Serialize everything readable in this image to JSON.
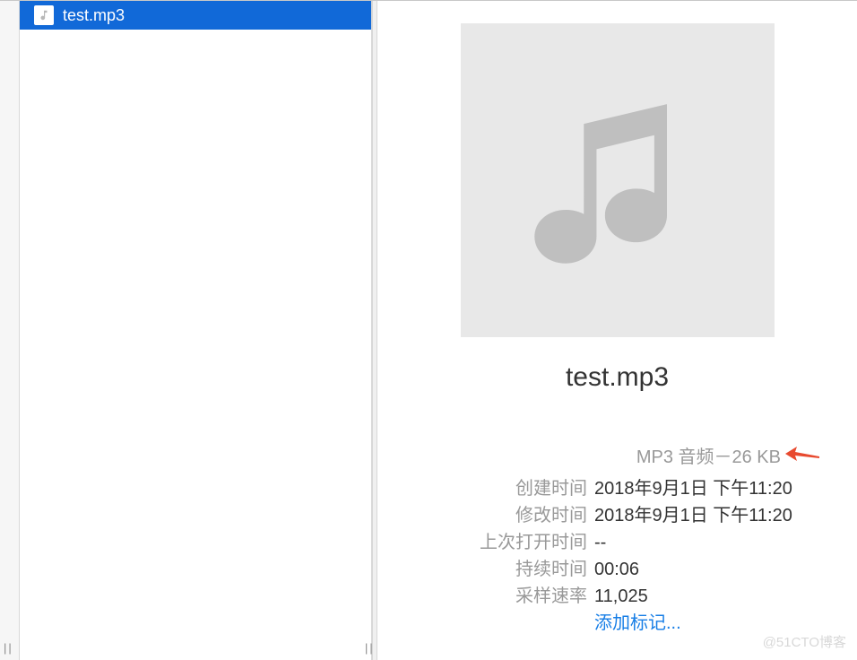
{
  "file_list": {
    "items": [
      {
        "name": "test.mp3"
      }
    ]
  },
  "preview": {
    "title": "test.mp3",
    "type_line": "MP3 音频－26 KB",
    "rows": [
      {
        "label": "创建时间",
        "value": "2018年9月1日 下午11:20"
      },
      {
        "label": "修改时间",
        "value": "2018年9月1日 下午11:20"
      },
      {
        "label": "上次打开时间",
        "value": "--"
      },
      {
        "label": "持续时间",
        "value": "00:06"
      },
      {
        "label": "采样速率",
        "value": "11,025"
      }
    ],
    "add_tags": "添加标记..."
  },
  "watermark": "@51CTO博客"
}
